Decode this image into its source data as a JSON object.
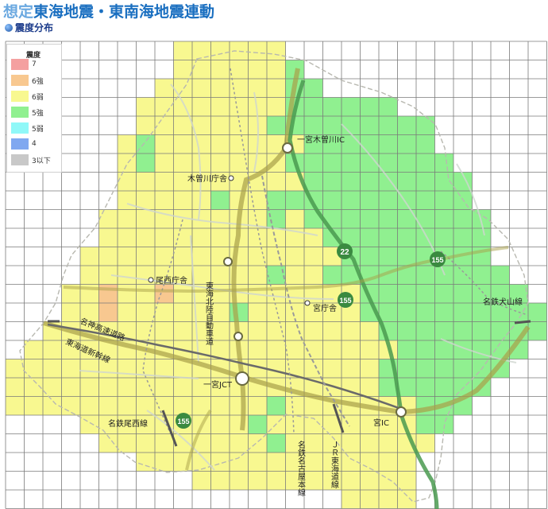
{
  "header": {
    "title_prefix": "想定",
    "title_main": "東海地震・東南海地震連動",
    "subtitle": "震度分布"
  },
  "legend": {
    "title": "震度",
    "items": [
      {
        "label": "7",
        "color": "#f4a0a0"
      },
      {
        "label": "6強",
        "color": "#f8c890"
      },
      {
        "label": "6弱",
        "color": "#f8f890"
      },
      {
        "label": "5強",
        "color": "#90f090"
      },
      {
        "label": "5弱",
        "color": "#90f8f8"
      },
      {
        "label": "4",
        "color": "#80a8f0"
      },
      {
        "label": "3以下",
        "color": "#c8c8c8"
      }
    ]
  },
  "map_labels": {
    "ichinomiya_kisogawa_ic": "一宮木曽川IC",
    "kisogawa_office": "木曽川庁舎",
    "bisai_office": "尾西庁舎",
    "miya_office": "宮庁舎",
    "tokai_hokuriku_expressway": "東海北陸自動車道",
    "meishin_expressway": "名神高速道路",
    "tokaido_shinkansen": "東海道新幹線",
    "ichinomiya_jct": "一宮JCT",
    "meitetsu_bisai_line": "名鉄尾西線",
    "meitetsu_nagoya_line": "名鉄名古屋本線",
    "jr_tokaido_line": "ＪＲ東海道線",
    "miya_ic": "宮IC",
    "meitetsu_inuyama_line": "名鉄犬山線",
    "route_22": "22",
    "route_155_a": "155",
    "route_155_b": "155",
    "route_155_c": "155"
  }
}
